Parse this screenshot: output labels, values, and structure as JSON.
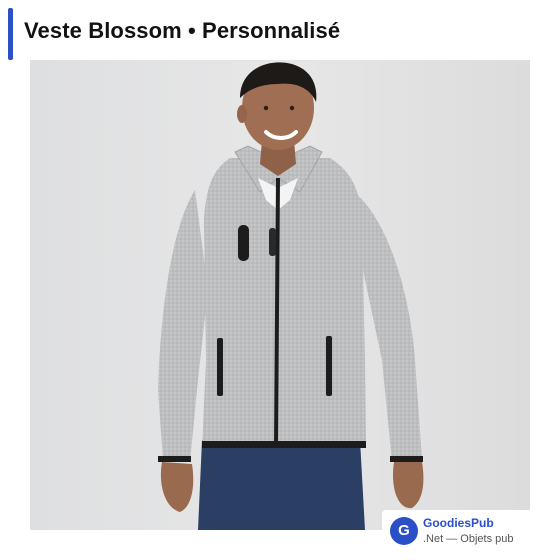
{
  "header": {
    "title": "Veste Blossom • Personnalisé"
  },
  "image": {
    "subject": "man wearing grey heathered knit fleece zip jacket",
    "colors": {
      "background": "#e3e3e4",
      "jacket": "#bdbfc1",
      "trim": "#1c1c1c",
      "jeans": "#2b3e63"
    }
  },
  "brand": {
    "logo_letter": "G",
    "name": "GoodiesPub",
    "tagline": ".Net — Objets pub",
    "color": "#2a4fc6"
  }
}
